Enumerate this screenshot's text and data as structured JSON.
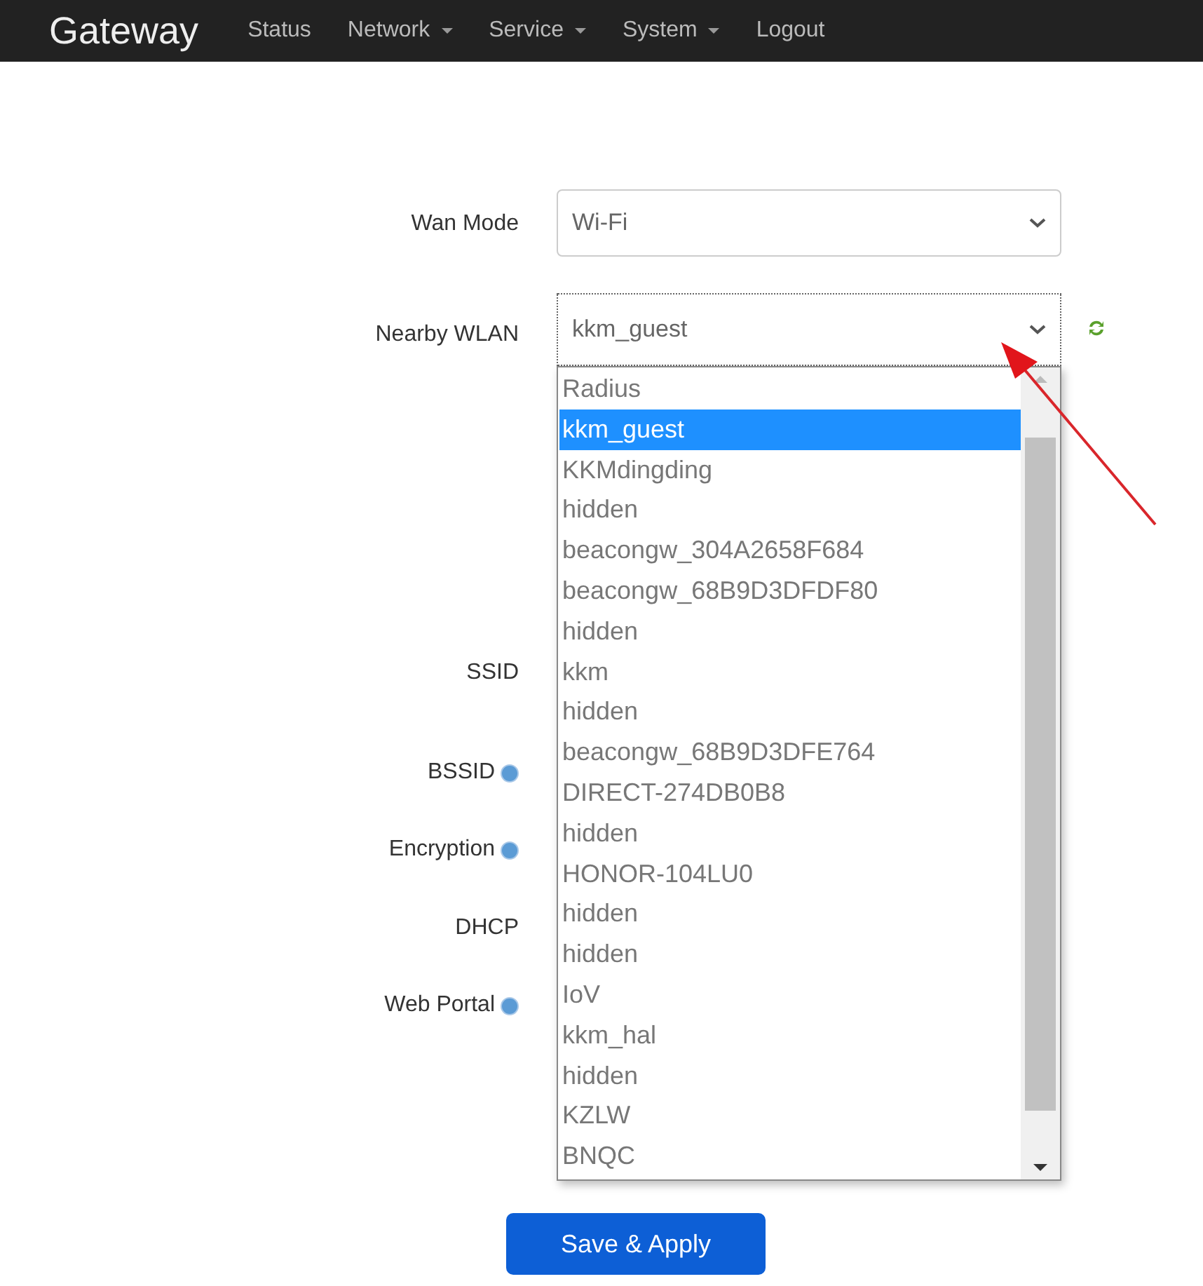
{
  "navbar": {
    "brand": "Gateway",
    "items": [
      {
        "label": "Status",
        "has_menu": false
      },
      {
        "label": "Network",
        "has_menu": true
      },
      {
        "label": "Service",
        "has_menu": true
      },
      {
        "label": "System",
        "has_menu": true
      },
      {
        "label": "Logout",
        "has_menu": false
      }
    ]
  },
  "wan_mode": {
    "label": "Wan Mode",
    "value": "Wi-Fi"
  },
  "nearby_wlan": {
    "label": "Nearby WLAN",
    "value": "kkm_guest",
    "expanded": true,
    "options": [
      {
        "label": "Radius",
        "selected": false
      },
      {
        "label": "kkm_guest",
        "selected": true
      },
      {
        "label": "KKMdingding",
        "selected": false
      },
      {
        "label": "hidden",
        "selected": false
      },
      {
        "label": "beacongw_304A2658F684",
        "selected": false
      },
      {
        "label": "beacongw_68B9D3DFDF80",
        "selected": false
      },
      {
        "label": "hidden",
        "selected": false
      },
      {
        "label": "kkm",
        "selected": false
      },
      {
        "label": "hidden",
        "selected": false
      },
      {
        "label": "beacongw_68B9D3DFE764",
        "selected": false
      },
      {
        "label": "DIRECT-274DB0B8",
        "selected": false
      },
      {
        "label": "hidden",
        "selected": false
      },
      {
        "label": "HONOR-104LU0",
        "selected": false
      },
      {
        "label": "hidden",
        "selected": false
      },
      {
        "label": "hidden",
        "selected": false
      },
      {
        "label": "IoV",
        "selected": false
      },
      {
        "label": "kkm_hal",
        "selected": false
      },
      {
        "label": "hidden",
        "selected": false
      },
      {
        "label": "KZLW",
        "selected": false
      },
      {
        "label": "BNQC",
        "selected": false
      }
    ]
  },
  "hidden_fields": [
    {
      "label": "SSID",
      "help": false
    },
    {
      "label": "BSSID",
      "help": true
    },
    {
      "label": "Encryption",
      "help": true
    },
    {
      "label": "DHCP",
      "help": false
    },
    {
      "label": "Web Portal",
      "help": true
    }
  ],
  "save_button": "Save & Apply"
}
